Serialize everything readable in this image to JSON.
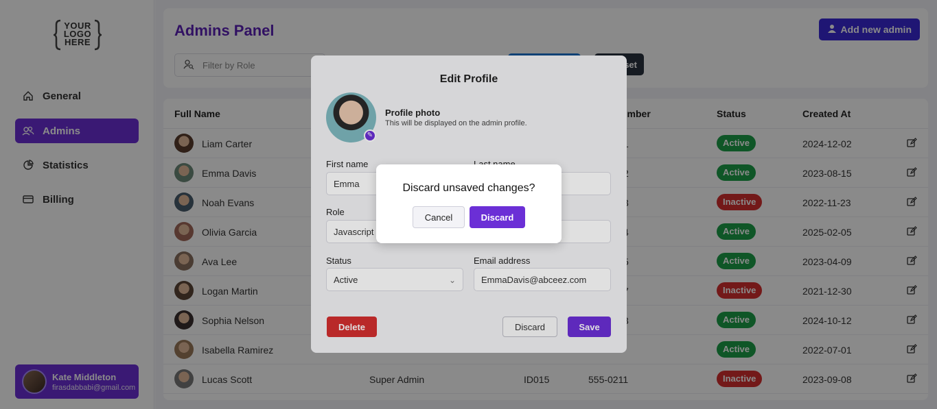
{
  "sidebar": {
    "logo_text": "YOUR LOGO HERE",
    "items": [
      {
        "label": "General",
        "icon": "home-icon"
      },
      {
        "label": "Admins",
        "icon": "users-icon"
      },
      {
        "label": "Statistics",
        "icon": "pie-chart-icon"
      },
      {
        "label": "Billing",
        "icon": "credit-card-icon"
      }
    ],
    "user": {
      "name": "Kate Middleton",
      "email": "firasdabbabi@gmail.com"
    }
  },
  "header": {
    "title": "Admins Panel",
    "add_button": "Add new admin",
    "filter_placeholder": "Filter by Role",
    "reset_label": "set"
  },
  "table": {
    "columns": [
      "Full Name",
      "umber",
      "Status",
      "Created At"
    ],
    "rows": [
      {
        "name": "Liam Carter",
        "role": "",
        "id": "",
        "phone": "",
        "status": "Active",
        "created": "2024-12-02"
      },
      {
        "name": "Emma Davis",
        "role": "",
        "id": "",
        "phone": "",
        "status": "Active",
        "created": "2023-08-15"
      },
      {
        "name": "Noah Evans",
        "role": "",
        "id": "",
        "phone": "",
        "status": "Inactive",
        "created": "2022-11-23"
      },
      {
        "name": "Olivia Garcia",
        "role": "",
        "id": "",
        "phone": "",
        "status": "Active",
        "created": "2025-02-05"
      },
      {
        "name": "Ava Lee",
        "role": "",
        "id": "",
        "phone": "",
        "status": "Active",
        "created": "2023-04-09"
      },
      {
        "name": "Logan Martin",
        "role": "",
        "id": "",
        "phone": "",
        "status": "Inactive",
        "created": "2021-12-30"
      },
      {
        "name": "Sophia Nelson",
        "role": "",
        "id": "",
        "phone": "",
        "status": "Active",
        "created": "2024-10-12"
      },
      {
        "name": "Isabella Ramirez",
        "role": "",
        "id": "",
        "phone": "",
        "status": "Active",
        "created": "2022-07-01"
      },
      {
        "name": "Lucas Scott",
        "role": "Super Admin",
        "id": "ID015",
        "phone": "555-0211",
        "status": "Inactive",
        "created": "2023-09-08"
      }
    ],
    "partial_cells": [
      "1",
      "2",
      "3",
      "4",
      "5",
      "7",
      "3",
      ""
    ]
  },
  "edit_modal": {
    "title": "Edit Profile",
    "photo_title": "Profile photo",
    "photo_subtitle": "This will be displayed on the admin profile.",
    "first_name_label": "First name",
    "first_name_value": "Emma",
    "last_name_label": "Last name",
    "role_label": "Role",
    "role_value": "Javascript d",
    "status_label": "Status",
    "status_value": "Active",
    "email_label": "Email address",
    "email_value": "EmmaDavis@abceez.com",
    "delete_label": "Delete",
    "discard_label": "Discard",
    "save_label": "Save"
  },
  "confirm": {
    "question": "Discard unsaved changes?",
    "cancel_label": "Cancel",
    "discard_label": "Discard"
  },
  "colors": {
    "accent": "#6b2fd6",
    "title": "#5b21b6",
    "active": "#1e9e4a",
    "inactive": "#d32f2f"
  }
}
